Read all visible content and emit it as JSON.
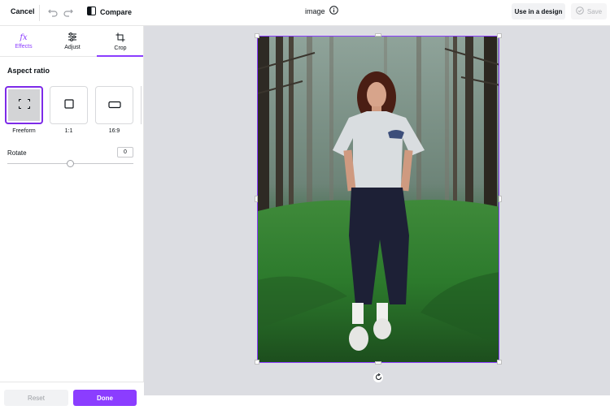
{
  "topbar": {
    "cancel_label": "Cancel",
    "compare_label": "Compare",
    "title": "image",
    "use_in_design_label": "Use in a design",
    "save_label": "Save"
  },
  "tabs": [
    {
      "label": "Effects",
      "icon": "fx-icon",
      "active": false
    },
    {
      "label": "Adjust",
      "icon": "sliders-icon",
      "active": false
    },
    {
      "label": "Crop",
      "icon": "crop-icon",
      "active": true
    }
  ],
  "crop": {
    "section_title": "Aspect ratio",
    "ratios": [
      {
        "label": "Freeform",
        "icon": "freeform-icon",
        "selected": true
      },
      {
        "label": "1:1",
        "icon": "square-icon",
        "selected": false
      },
      {
        "label": "16:9",
        "icon": "wide-rect-icon",
        "selected": false
      }
    ],
    "rotate_label": "Rotate",
    "rotate_value": "0",
    "rotate_slider_fraction": 0.5
  },
  "footer": {
    "reset_label": "Reset",
    "done_label": "Done"
  },
  "colors": {
    "accent": "#8b3dff",
    "canvas_bg": "#dcdde2"
  }
}
